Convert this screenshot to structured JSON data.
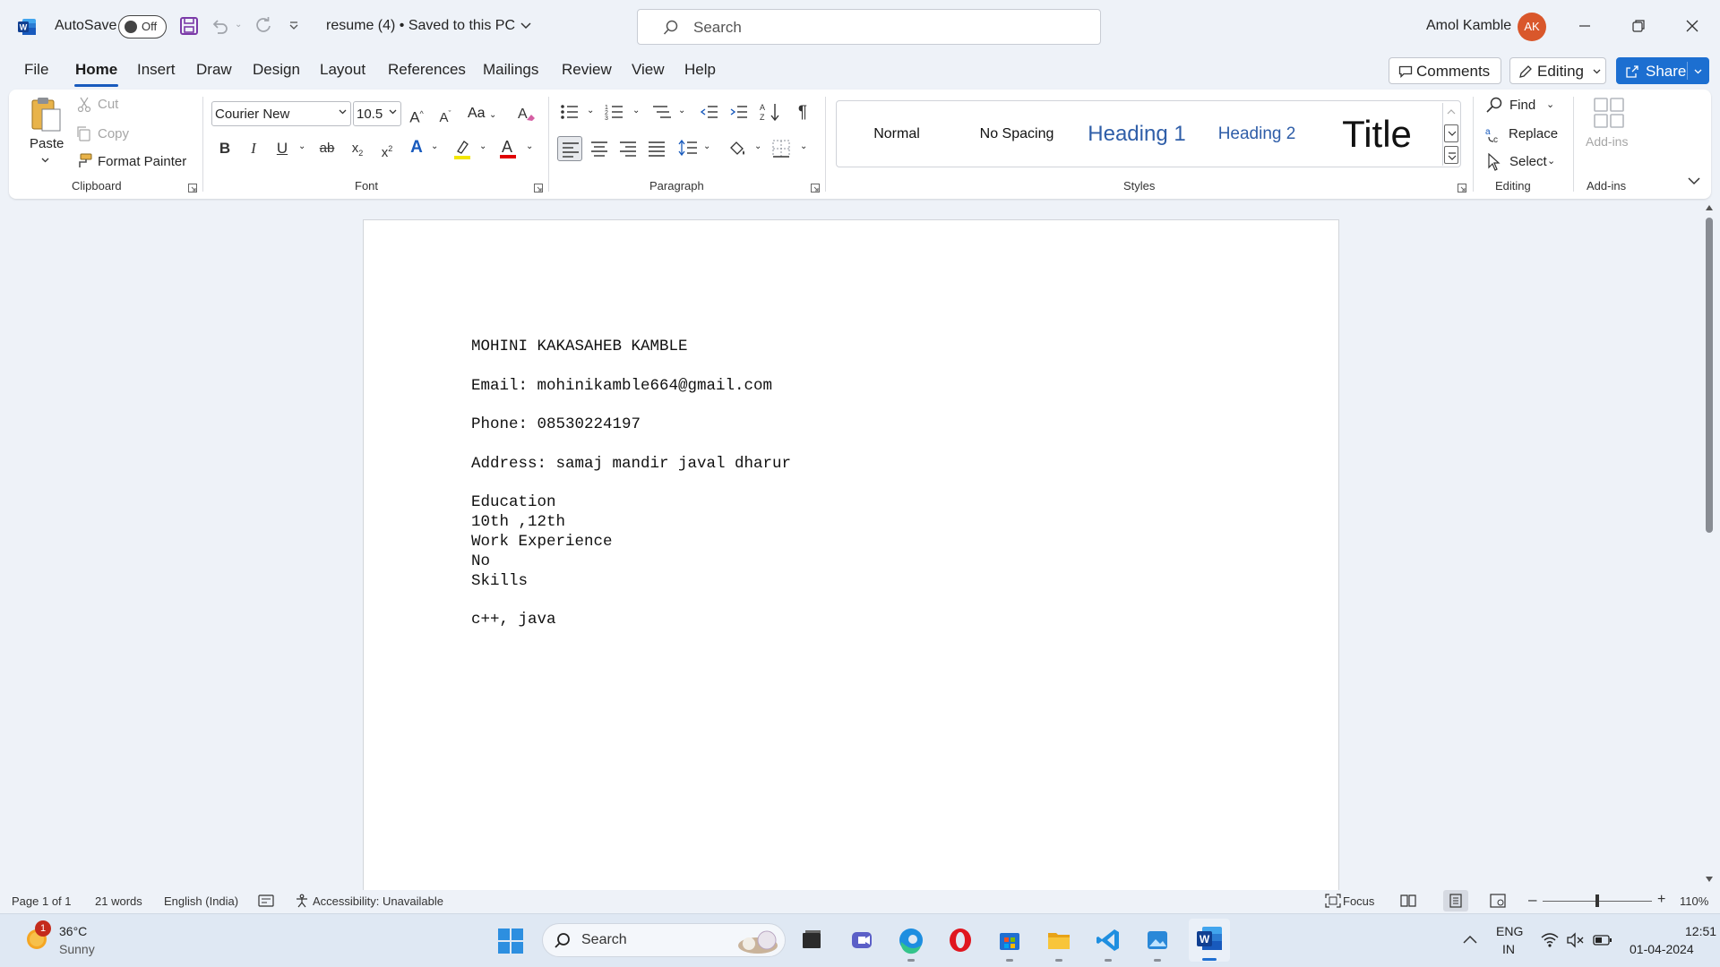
{
  "titlebar": {
    "autosave_label": "AutoSave",
    "autosave_state": "Off",
    "doc_title": "resume (4) • Saved to this PC",
    "search_placeholder": "Search",
    "user_name": "Amol Kamble",
    "user_initials": "AK"
  },
  "tabs": [
    "File",
    "Home",
    "Insert",
    "Draw",
    "Design",
    "Layout",
    "References",
    "Mailings",
    "Review",
    "View",
    "Help"
  ],
  "active_tab": "Home",
  "top_buttons": {
    "comments": "Comments",
    "editing": "Editing",
    "share": "Share"
  },
  "ribbon": {
    "clipboard": {
      "label": "Clipboard",
      "paste": "Paste",
      "cut": "Cut",
      "copy": "Copy",
      "format_painter": "Format Painter"
    },
    "font": {
      "label": "Font",
      "font_name": "Courier New",
      "font_size": "10.5",
      "change_case": "Aa"
    },
    "paragraph": {
      "label": "Paragraph"
    },
    "styles": {
      "label": "Styles",
      "items": [
        "Normal",
        "No Spacing",
        "Heading 1",
        "Heading 2",
        "Title"
      ]
    },
    "editing": {
      "label": "Editing",
      "find": "Find",
      "replace": "Replace",
      "select": "Select"
    },
    "addins": {
      "label": "Add-ins",
      "button": "Add-ins"
    }
  },
  "document": {
    "lines": [
      "MOHINI KAKASAHEB KAMBLE",
      "Email: mohinikamble664@gmail.com",
      "Phone: 08530224197",
      "Address: samaj mandir javal dharur",
      "Education",
      "10th ,12th",
      "Work Experience",
      "No",
      "Skills",
      "c++, java"
    ]
  },
  "statusbar": {
    "page": "Page 1 of 1",
    "words": "21 words",
    "language": "English (India)",
    "accessibility": "Accessibility: Unavailable",
    "focus": "Focus",
    "zoom": "110%"
  },
  "taskbar": {
    "weather_temp": "36°C",
    "weather_desc": "Sunny",
    "weather_badge": "1",
    "search_label": "Search",
    "lang_top": "ENG",
    "lang_bottom": "IN",
    "time": "12:51",
    "date": "01-04-2024"
  },
  "colors": {
    "accent": "#185abd",
    "share_button": "#1c6fd1",
    "avatar": "#d9572b",
    "word_blue": "#185abd"
  }
}
